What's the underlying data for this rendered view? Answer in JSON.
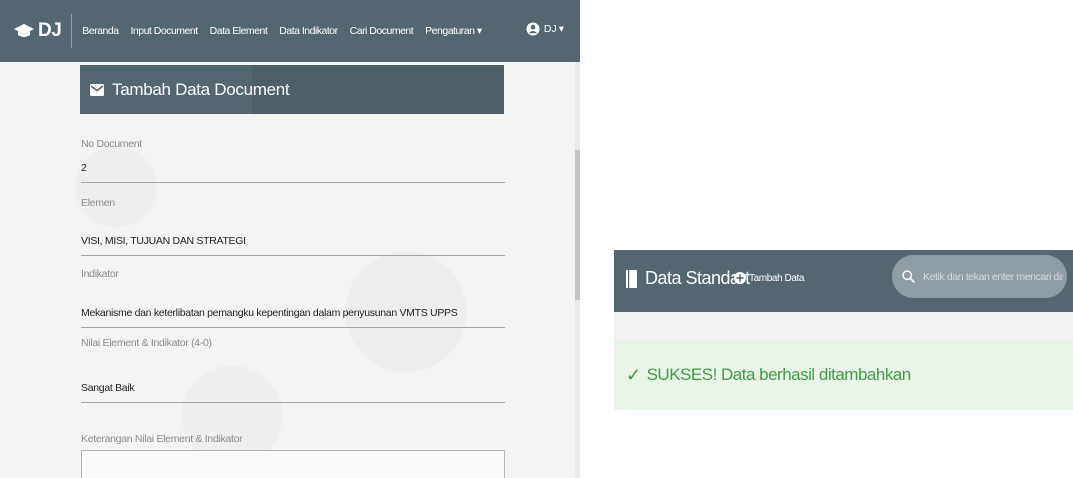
{
  "navbar": {
    "brand": "DJ",
    "items": [
      "Beranda",
      "Input Document",
      "Data Element",
      "Data Indikator",
      "Cari Document",
      "Pengaturan"
    ],
    "dropdown_caret": "▾",
    "user": "DJ",
    "user_caret": "▾"
  },
  "form": {
    "title": "Tambah Data Document",
    "fields": [
      {
        "label": "No Document",
        "value": "2"
      },
      {
        "label": "Elemen",
        "value": "VISI, MISI, TUJUAN DAN STRATEGI"
      },
      {
        "label": "Indikator",
        "value": "Mekanisme dan keterlibatan pemangku kepentingan dalam penyusunan VMTS UPPS"
      },
      {
        "label": "Nilai Element & Indikator (4-0)",
        "value": "Sangat Baik"
      },
      {
        "label": "Keterangan Nilai Element & Indikator",
        "value": ""
      }
    ]
  },
  "standart": {
    "title": "Data Standart",
    "add_label": "Tambah Data",
    "search_placeholder": "Ketik dan tekan enter mencari data..."
  },
  "alert": {
    "check": "✓",
    "message": "SUKSES! Data berhasil ditambahkan",
    "color": "#3f9d46"
  },
  "colors": {
    "navbar": "#54666f",
    "alert_bg": "#e9f5e9"
  },
  "icons": {
    "brand": "graduation-cap-icon",
    "card": "envelope-icon",
    "user": "user-circle-icon",
    "standart": "book-icon",
    "add": "plus-circle-icon",
    "search": "search-icon"
  }
}
